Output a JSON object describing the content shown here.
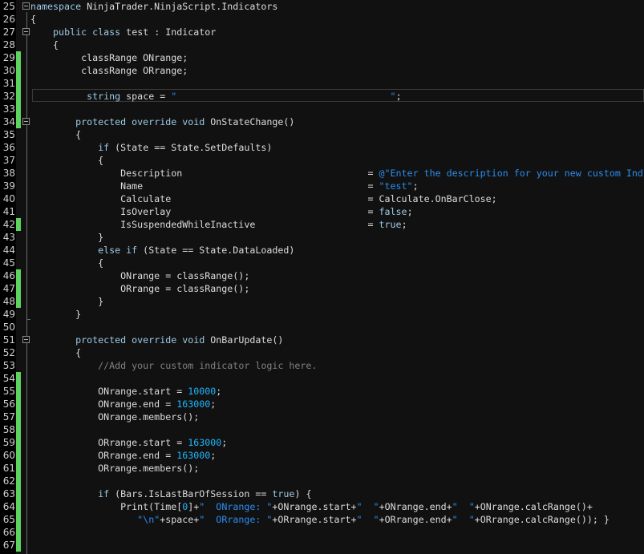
{
  "editor": {
    "colors": {
      "background": "#111111",
      "keyword": "#9ccbe6",
      "string": "#2a8df0",
      "number": "#1fb6ff",
      "comment": "#808080",
      "text": "#dcdcdc",
      "changed_marker": "#5fd35f"
    },
    "current_line": 32,
    "lines": [
      {
        "n": "25",
        "changed": false,
        "t": [
          [
            "kw",
            "namespace"
          ],
          [
            "tx",
            " NinjaTrader.NinjaScript.Indicators"
          ]
        ]
      },
      {
        "n": "26",
        "changed": false,
        "t": [
          [
            "tx",
            "{"
          ]
        ]
      },
      {
        "n": "27",
        "changed": false,
        "t": [
          [
            "tx",
            "    "
          ],
          [
            "kw",
            "public"
          ],
          [
            "tx",
            " "
          ],
          [
            "kw",
            "class"
          ],
          [
            "tx",
            " test : Indicator"
          ]
        ]
      },
      {
        "n": "28",
        "changed": false,
        "t": [
          [
            "tx",
            "    {"
          ]
        ]
      },
      {
        "n": "29",
        "changed": true,
        "t": [
          [
            "tx",
            "         classRange ONrange;"
          ]
        ]
      },
      {
        "n": "30",
        "changed": true,
        "t": [
          [
            "tx",
            "         classRange ORrange;"
          ]
        ]
      },
      {
        "n": "31",
        "changed": true,
        "t": []
      },
      {
        "n": "32",
        "changed": true,
        "t": [
          [
            "tx",
            "          "
          ],
          [
            "kw",
            "string"
          ],
          [
            "tx",
            " space = "
          ],
          [
            "str",
            "\"                                      \""
          ],
          [
            "tx",
            ";"
          ]
        ]
      },
      {
        "n": "33",
        "changed": true,
        "t": []
      },
      {
        "n": "34",
        "changed": true,
        "t": [
          [
            "tx",
            "        "
          ],
          [
            "kw",
            "protected override void"
          ],
          [
            "tx",
            " OnStateChange()"
          ]
        ]
      },
      {
        "n": "35",
        "changed": false,
        "t": [
          [
            "tx",
            "        {"
          ]
        ]
      },
      {
        "n": "36",
        "changed": false,
        "t": [
          [
            "tx",
            "            "
          ],
          [
            "kw",
            "if"
          ],
          [
            "tx",
            " (State == State.SetDefaults)"
          ]
        ]
      },
      {
        "n": "37",
        "changed": false,
        "t": [
          [
            "tx",
            "            {"
          ]
        ]
      },
      {
        "n": "38",
        "changed": false,
        "t": [
          [
            "tx",
            "                Description                                 = "
          ],
          [
            "str",
            "@\"Enter the description for your new custom Ind"
          ]
        ]
      },
      {
        "n": "39",
        "changed": false,
        "t": [
          [
            "tx",
            "                Name                                        = "
          ],
          [
            "str",
            "\"test\""
          ],
          [
            "tx",
            ";"
          ]
        ]
      },
      {
        "n": "40",
        "changed": false,
        "t": [
          [
            "tx",
            "                Calculate                                   = Calculate.OnBarClose;"
          ]
        ]
      },
      {
        "n": "41",
        "changed": false,
        "t": [
          [
            "tx",
            "                IsOverlay                                   = "
          ],
          [
            "kw",
            "false"
          ],
          [
            "tx",
            ";"
          ]
        ]
      },
      {
        "n": "42",
        "changed": true,
        "t": [
          [
            "tx",
            "                IsSuspendedWhileInactive                    = "
          ],
          [
            "kw",
            "true"
          ],
          [
            "tx",
            ";"
          ]
        ]
      },
      {
        "n": "43",
        "changed": false,
        "t": [
          [
            "tx",
            "            }"
          ]
        ]
      },
      {
        "n": "44",
        "changed": false,
        "t": [
          [
            "tx",
            "            "
          ],
          [
            "kw",
            "else if"
          ],
          [
            "tx",
            " (State == State.DataLoaded)"
          ]
        ]
      },
      {
        "n": "45",
        "changed": false,
        "t": [
          [
            "tx",
            "            {"
          ]
        ]
      },
      {
        "n": "46",
        "changed": true,
        "t": [
          [
            "tx",
            "                ONrange = classRange();"
          ]
        ]
      },
      {
        "n": "47",
        "changed": true,
        "t": [
          [
            "tx",
            "                ORrange = classRange();"
          ]
        ]
      },
      {
        "n": "48",
        "changed": true,
        "t": [
          [
            "tx",
            "            }"
          ]
        ]
      },
      {
        "n": "49",
        "changed": false,
        "t": [
          [
            "tx",
            "        }"
          ]
        ]
      },
      {
        "n": "50",
        "changed": false,
        "t": []
      },
      {
        "n": "51",
        "changed": false,
        "t": [
          [
            "tx",
            "        "
          ],
          [
            "kw",
            "protected override void"
          ],
          [
            "tx",
            " OnBarUpdate()"
          ]
        ]
      },
      {
        "n": "52",
        "changed": false,
        "t": [
          [
            "tx",
            "        {"
          ]
        ]
      },
      {
        "n": "53",
        "changed": false,
        "t": [
          [
            "tx",
            "            "
          ],
          [
            "cm",
            "//Add your custom indicator logic here."
          ]
        ]
      },
      {
        "n": "54",
        "changed": true,
        "t": []
      },
      {
        "n": "55",
        "changed": true,
        "t": [
          [
            "tx",
            "            ONrange.start = "
          ],
          [
            "num",
            "10000"
          ],
          [
            "tx",
            ";"
          ]
        ]
      },
      {
        "n": "56",
        "changed": true,
        "t": [
          [
            "tx",
            "            ONrange.end = "
          ],
          [
            "num",
            "163000"
          ],
          [
            "tx",
            ";"
          ]
        ]
      },
      {
        "n": "57",
        "changed": true,
        "t": [
          [
            "tx",
            "            ONrange.members();"
          ]
        ]
      },
      {
        "n": "58",
        "changed": true,
        "t": []
      },
      {
        "n": "59",
        "changed": true,
        "t": [
          [
            "tx",
            "            ORrange.start = "
          ],
          [
            "num",
            "163000"
          ],
          [
            "tx",
            ";"
          ]
        ]
      },
      {
        "n": "60",
        "changed": true,
        "t": [
          [
            "tx",
            "            ORrange.end = "
          ],
          [
            "num",
            "163000"
          ],
          [
            "tx",
            ";"
          ]
        ]
      },
      {
        "n": "61",
        "changed": true,
        "t": [
          [
            "tx",
            "            ORrange.members();"
          ]
        ]
      },
      {
        "n": "62",
        "changed": true,
        "t": []
      },
      {
        "n": "63",
        "changed": true,
        "t": [
          [
            "tx",
            "            "
          ],
          [
            "kw",
            "if"
          ],
          [
            "tx",
            " (Bars.IsLastBarOfSession == "
          ],
          [
            "kw",
            "true"
          ],
          [
            "tx",
            ") {"
          ]
        ]
      },
      {
        "n": "64",
        "changed": true,
        "t": [
          [
            "tx",
            "                Print(Time["
          ],
          [
            "num",
            "0"
          ],
          [
            "tx",
            "]+"
          ],
          [
            "str",
            "\"  ONrange: \""
          ],
          [
            "tx",
            "+ONrange.start+"
          ],
          [
            "str",
            "\"  \""
          ],
          [
            "tx",
            "+ONrange.end+"
          ],
          [
            "str",
            "\"  \""
          ],
          [
            "tx",
            "+ONrange.calcRange()+"
          ]
        ]
      },
      {
        "n": "65",
        "changed": true,
        "t": [
          [
            "tx",
            "                   "
          ],
          [
            "str",
            "\"\\n\""
          ],
          [
            "tx",
            "+space+"
          ],
          [
            "str",
            "\"  ORrange: \""
          ],
          [
            "tx",
            "+ORrange.start+"
          ],
          [
            "str",
            "\"  \""
          ],
          [
            "tx",
            "+ORrange.end+"
          ],
          [
            "str",
            "\"  \""
          ],
          [
            "tx",
            "+ORrange.calcRange()); }"
          ]
        ]
      },
      {
        "n": "66",
        "changed": true,
        "t": []
      },
      {
        "n": "67",
        "changed": true,
        "t": []
      }
    ]
  }
}
